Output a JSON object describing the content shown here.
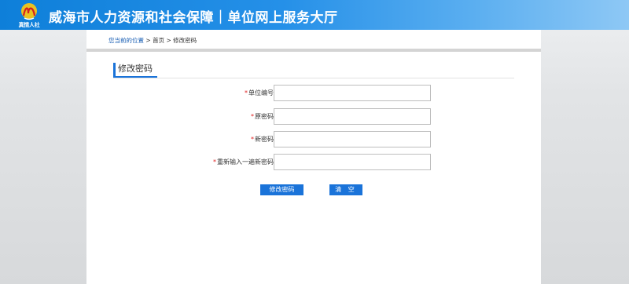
{
  "header": {
    "logo_text": "真情人社",
    "title": "威海市人力资源和社会保障｜单位网上服务大厅",
    "logo_icon": "swirl-logo-icon",
    "colors": {
      "primary": "#1a73d9",
      "required": "#e02020"
    }
  },
  "breadcrumb": {
    "label": "您当前的位置",
    "separator": ">",
    "items": [
      "首页",
      "修改密码"
    ]
  },
  "form": {
    "section_title": "修改密码",
    "required_mark": "*",
    "fields": [
      {
        "label": "单位编号",
        "value": ""
      },
      {
        "label": "原密码",
        "value": ""
      },
      {
        "label": "新密码",
        "value": ""
      },
      {
        "label": "重新输入一遍新密码",
        "value": ""
      }
    ],
    "buttons": {
      "submit": "修改密码",
      "clear": "清 空"
    }
  }
}
